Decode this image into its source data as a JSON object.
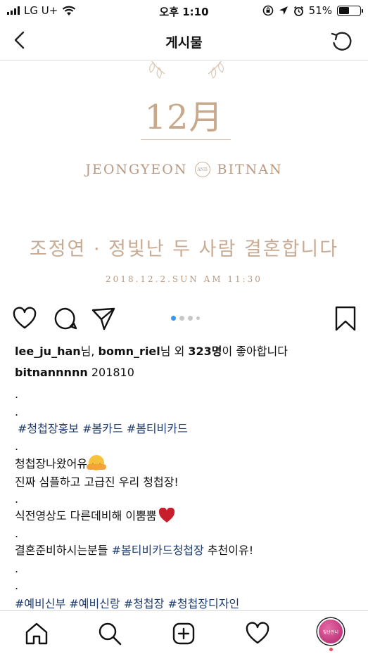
{
  "status_bar": {
    "carrier": "LG U+",
    "time": "오후 1:10",
    "battery": "51%",
    "battery_level": 0.51
  },
  "header": {
    "title": "게시물"
  },
  "post_image": {
    "month": "12月",
    "groom": "JEONGYEON",
    "and": "AND",
    "bride": "BITNAN",
    "headline": "조정연 · 정빛난 두 사람 결혼합니다",
    "date": "2018.12.2.SUN AM 11:30"
  },
  "carousel": {
    "count": 4,
    "active_index": 0
  },
  "likes": {
    "user1": "lee_ju_han",
    "sep1": "님, ",
    "user2": "bomn_riel",
    "sep2": "님 외 ",
    "count": "323명",
    "suffix": "이 좋아합니다"
  },
  "caption": {
    "username": "bitnannnnn",
    "code": "201810",
    "dot1": ".",
    "dot2": ".",
    "tags1": [
      "#청첩장홍보",
      "#봄카드",
      "#봄티비카드"
    ],
    "dot3": ".",
    "line_emoji": "청첩장나왔어유",
    "line2": "진짜 심플하고 고급진 우리 청첩장!",
    "dot4": ".",
    "line3": "식전영상도 다른데비해 이뿜뿜",
    "dot5": ".",
    "line4_pre": "결혼준비하시는분들 ",
    "line4_tag": "#봄티비카드청첩장",
    "line4_post": " 추천이유!",
    "dot6": ".",
    "dot7": ".",
    "tags2": [
      "#예비신부",
      "#예비신랑",
      "#청첩장",
      "#청첩장디자인"
    ]
  },
  "tabbar": {
    "avatar_text": "빛난언니"
  },
  "colors": {
    "hashtag": "#1d3b6e",
    "gold": "#c9ab93",
    "active_dot": "#3897f0",
    "notification": "#ed4956"
  },
  "icons": [
    "back-chevron-icon",
    "refresh-icon",
    "heart-icon",
    "comment-icon",
    "share-icon",
    "bookmark-icon",
    "home-icon",
    "search-icon",
    "add-post-icon",
    "activity-heart-icon",
    "hug-emoji-icon",
    "red-heart-icon",
    "wifi-icon",
    "location-icon",
    "alarm-icon",
    "orientation-lock-icon"
  ]
}
